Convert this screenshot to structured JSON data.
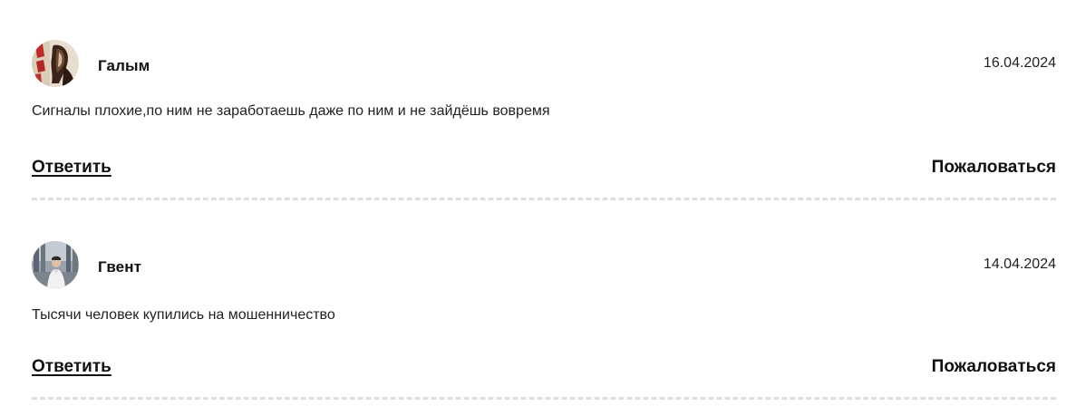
{
  "comments": [
    {
      "author": "Галым",
      "avatar_icon": "user-avatar-photo",
      "date": "16.04.2024",
      "text": "Сигналы плохие,по ним не заработаешь даже по ним и не зайдёшь вовремя",
      "reply_label": "Ответить",
      "report_label": "Пожаловаться"
    },
    {
      "author": "Гвент",
      "avatar_icon": "user-avatar-photo",
      "date": "14.04.2024",
      "text": "Тысячи человек купились на мошенничество",
      "reply_label": "Ответить",
      "report_label": "Пожаловаться"
    }
  ],
  "colors": {
    "text": "#111111",
    "divider": "#dedede",
    "background": "#ffffff"
  }
}
